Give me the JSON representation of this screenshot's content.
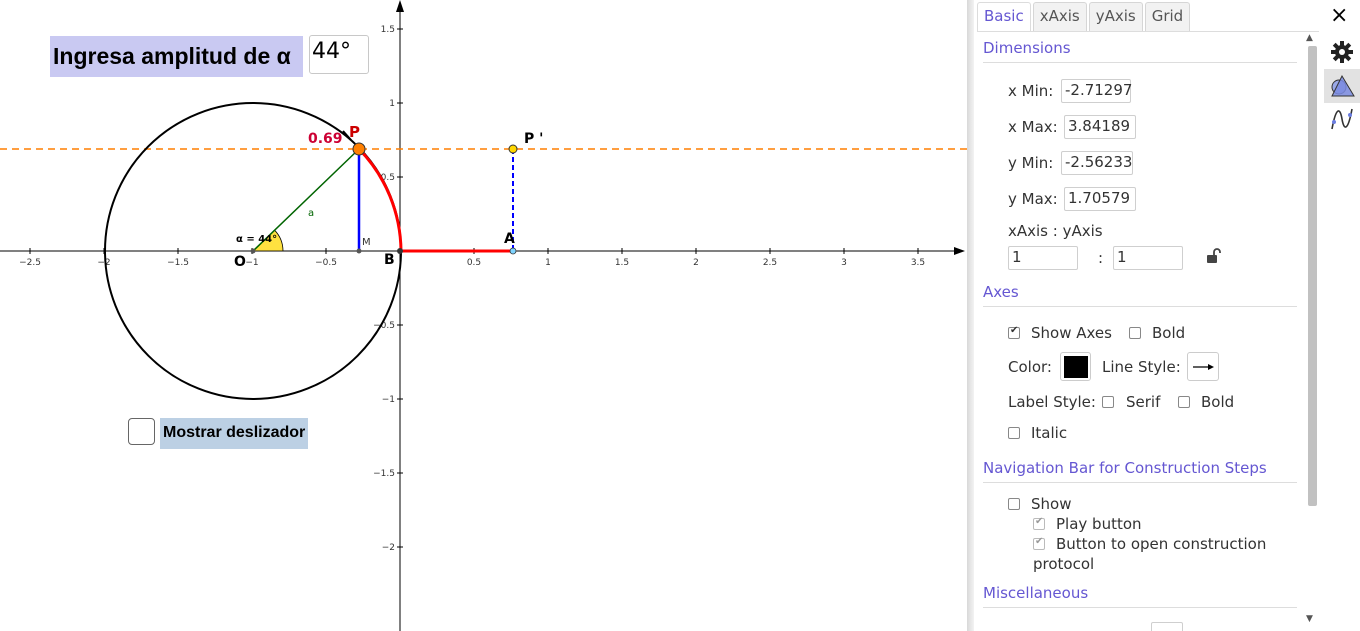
{
  "graphics": {
    "title": "Ingresa amplitud de α",
    "alpha_value": "44°",
    "slider_label": "Mostrar deslizador",
    "x_ticks": [
      "−2.5",
      "−2",
      "−1.5",
      "−1",
      "−0.5",
      "0.5",
      "1",
      "1.5",
      "2",
      "2.5",
      "3",
      "3.5"
    ],
    "y_ticks": [
      "1.5",
      "1",
      "0.5",
      "−0.5",
      "−1",
      "−1.5",
      "−2"
    ],
    "point_labels": {
      "P": "P",
      "P_prime": "P '",
      "O": "O",
      "B": "B",
      "M": "M",
      "A": "A",
      "a": "a"
    },
    "value_label": "0.69",
    "angle_label": "α = 44°",
    "colors": {
      "arc_red": "#ff0000",
      "segment_blue": "#0000ff",
      "radius_green": "#006400",
      "dashed_orange": "#ff7f00",
      "point_orange": "#ff7f00",
      "angle_fill": "#ffd700",
      "title_bg": "#c9c9f2",
      "slider_label_bg": "#bcd0e4"
    }
  },
  "panel": {
    "tabs": [
      {
        "label": "Basic",
        "active": true
      },
      {
        "label": "xAxis",
        "active": false
      },
      {
        "label": "yAxis",
        "active": false
      },
      {
        "label": "Grid",
        "active": false
      }
    ],
    "dimensions": {
      "title": "Dimensions",
      "xmin_label": "x Min:",
      "xmin": "-2.71297",
      "xmax_label": "x Max:",
      "xmax": "3.84189",
      "ymin_label": "y Min:",
      "ymin": "-2.56233",
      "ymax_label": "y Max:",
      "ymax": "1.70579",
      "ratio_label": "xAxis : yAxis",
      "ratio_x": "1",
      "ratio_sep": ":",
      "ratio_y": "1",
      "lock_icon": "unlocked-padlock-icon"
    },
    "axes": {
      "title": "Axes",
      "show_axes": "Show Axes",
      "show_axes_checked": true,
      "bold": "Bold",
      "bold_checked": false,
      "color_label": "Color:",
      "color": "#000000",
      "line_style_label": "Line Style:",
      "label_style_label": "Label Style:",
      "serif": "Serif",
      "serif_checked": false,
      "bold2": "Bold",
      "bold2_checked": false,
      "italic": "Italic",
      "italic_checked": false
    },
    "navbar": {
      "title": "Navigation Bar for Construction Steps",
      "show": "Show",
      "show_checked": false,
      "play": "Play button",
      "play_checked": true,
      "protocol_line1": "Button to open construction",
      "protocol_line2": "protocol",
      "protocol_checked": true
    },
    "misc": {
      "title": "Miscellaneous"
    }
  },
  "toolbar": {
    "close_icon": "×",
    "icons": [
      "gear-icon",
      "graphics-style-icon",
      "algebra-curve-icon"
    ]
  }
}
